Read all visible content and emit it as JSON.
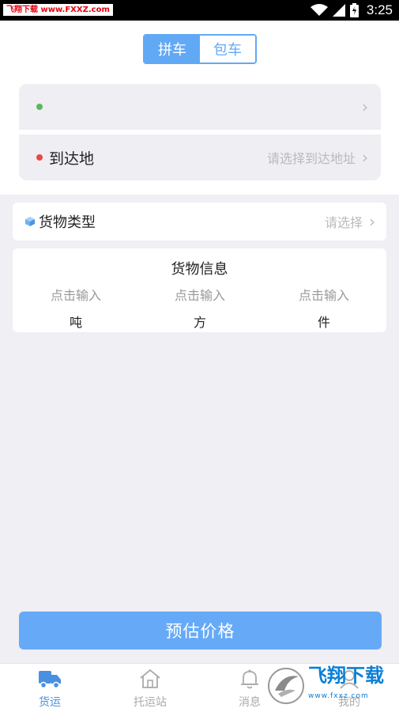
{
  "status_bar": {
    "time": "3:25",
    "watermark": "飞翔下载 www.FXXZ.com"
  },
  "segment": {
    "options": [
      "拼车",
      "包车"
    ],
    "selected": "拼车"
  },
  "address": {
    "origin": {
      "label": "",
      "placeholder": ""
    },
    "destination": {
      "label": "到达地",
      "placeholder": "请选择到达地址"
    }
  },
  "goods_type": {
    "label": "货物类型",
    "placeholder": "请选择"
  },
  "goods_info": {
    "title": "货物信息",
    "fields": [
      {
        "input_hint": "点击输入",
        "unit": "吨"
      },
      {
        "input_hint": "点击输入",
        "unit": "方"
      },
      {
        "input_hint": "点击输入",
        "unit": "件"
      }
    ]
  },
  "estimate_button": "预估价格",
  "tabbar": {
    "items": [
      "货运",
      "托运站",
      "消息",
      "我的"
    ],
    "active": "货运"
  },
  "colors": {
    "accent": "#62a9f5",
    "button": "#66aaf7",
    "active_tab": "#4a90e2"
  },
  "logo_watermark": {
    "title": "飞翔下载",
    "subtitle": "www.fxxz.com"
  }
}
